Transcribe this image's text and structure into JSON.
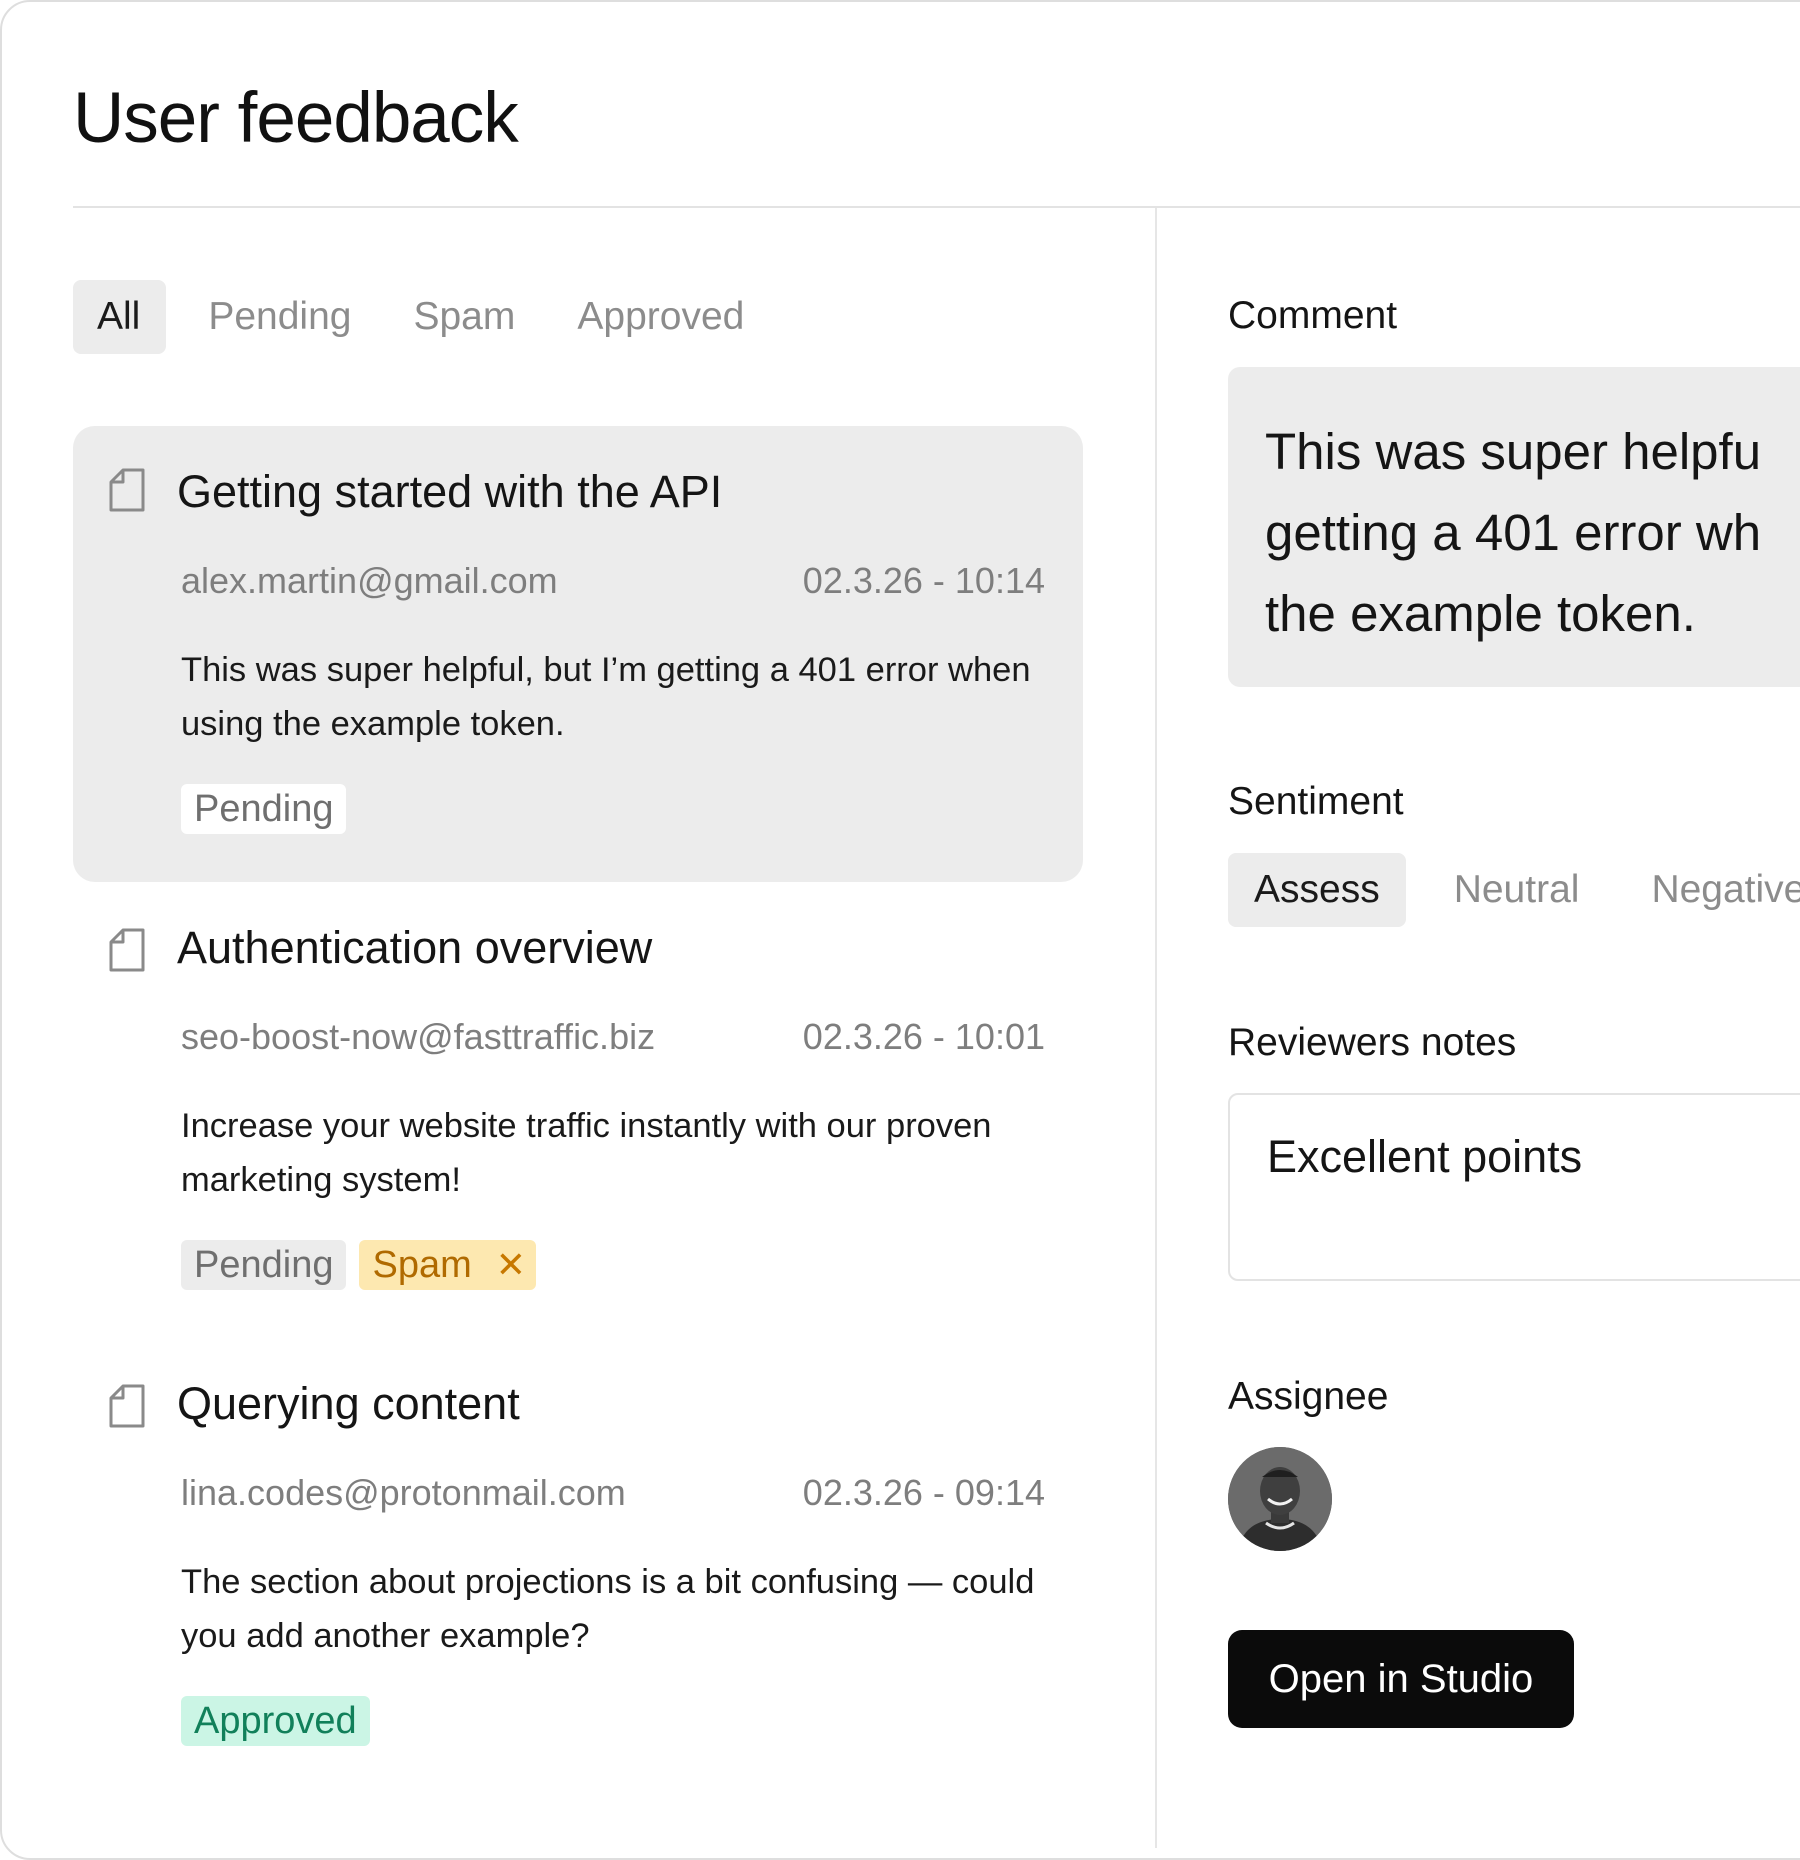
{
  "page": {
    "title": "User feedback"
  },
  "filter_tabs": [
    {
      "label": "All"
    },
    {
      "label": "Pending"
    },
    {
      "label": "Spam"
    },
    {
      "label": "Approved"
    }
  ],
  "feedback_items": [
    {
      "title": "Getting started with the API",
      "email": "alex.martin@gmail.com",
      "timestamp": "02.3.26 - 10:14",
      "comment": "This was super helpful, but I’m getting a 401 error when using the example token.",
      "tags": [
        "Pending"
      ]
    },
    {
      "title": "Authentication overview",
      "email": "seo-boost-now@fasttraffic.biz",
      "timestamp": "02.3.26 - 10:01",
      "comment": "Increase your website traffic instantly with our proven marketing system!",
      "tags": [
        "Pending",
        "Spam"
      ]
    },
    {
      "title": "Querying content",
      "email": "lina.codes@protonmail.com",
      "timestamp": "02.3.26 - 09:14",
      "comment": "The section about projections is a bit confusing — could you add another example?",
      "tags": [
        "Approved"
      ]
    }
  ],
  "detail": {
    "comment_label": "Comment",
    "comment_lines": [
      "This was super helpfu",
      "getting a 401 error wh",
      "the example token."
    ],
    "sentiment_label": "Sentiment",
    "sentiment_options": [
      "Assess",
      "Neutral",
      "Negative"
    ],
    "notes_label": "Reviewers notes",
    "notes_value": "Excellent points",
    "assignee_label": "Assignee",
    "open_button": "Open in Studio"
  },
  "icons": {
    "item_icon": "document-icon",
    "spam_remove": "close-icon"
  },
  "colors": {
    "selected_bg": "#ececec",
    "spam_bg": "#fde8b0",
    "spam_text": "#b06a00",
    "approved_bg": "#cbf5e5",
    "approved_text": "#11805a",
    "primary_button": "#0b0b0b"
  }
}
